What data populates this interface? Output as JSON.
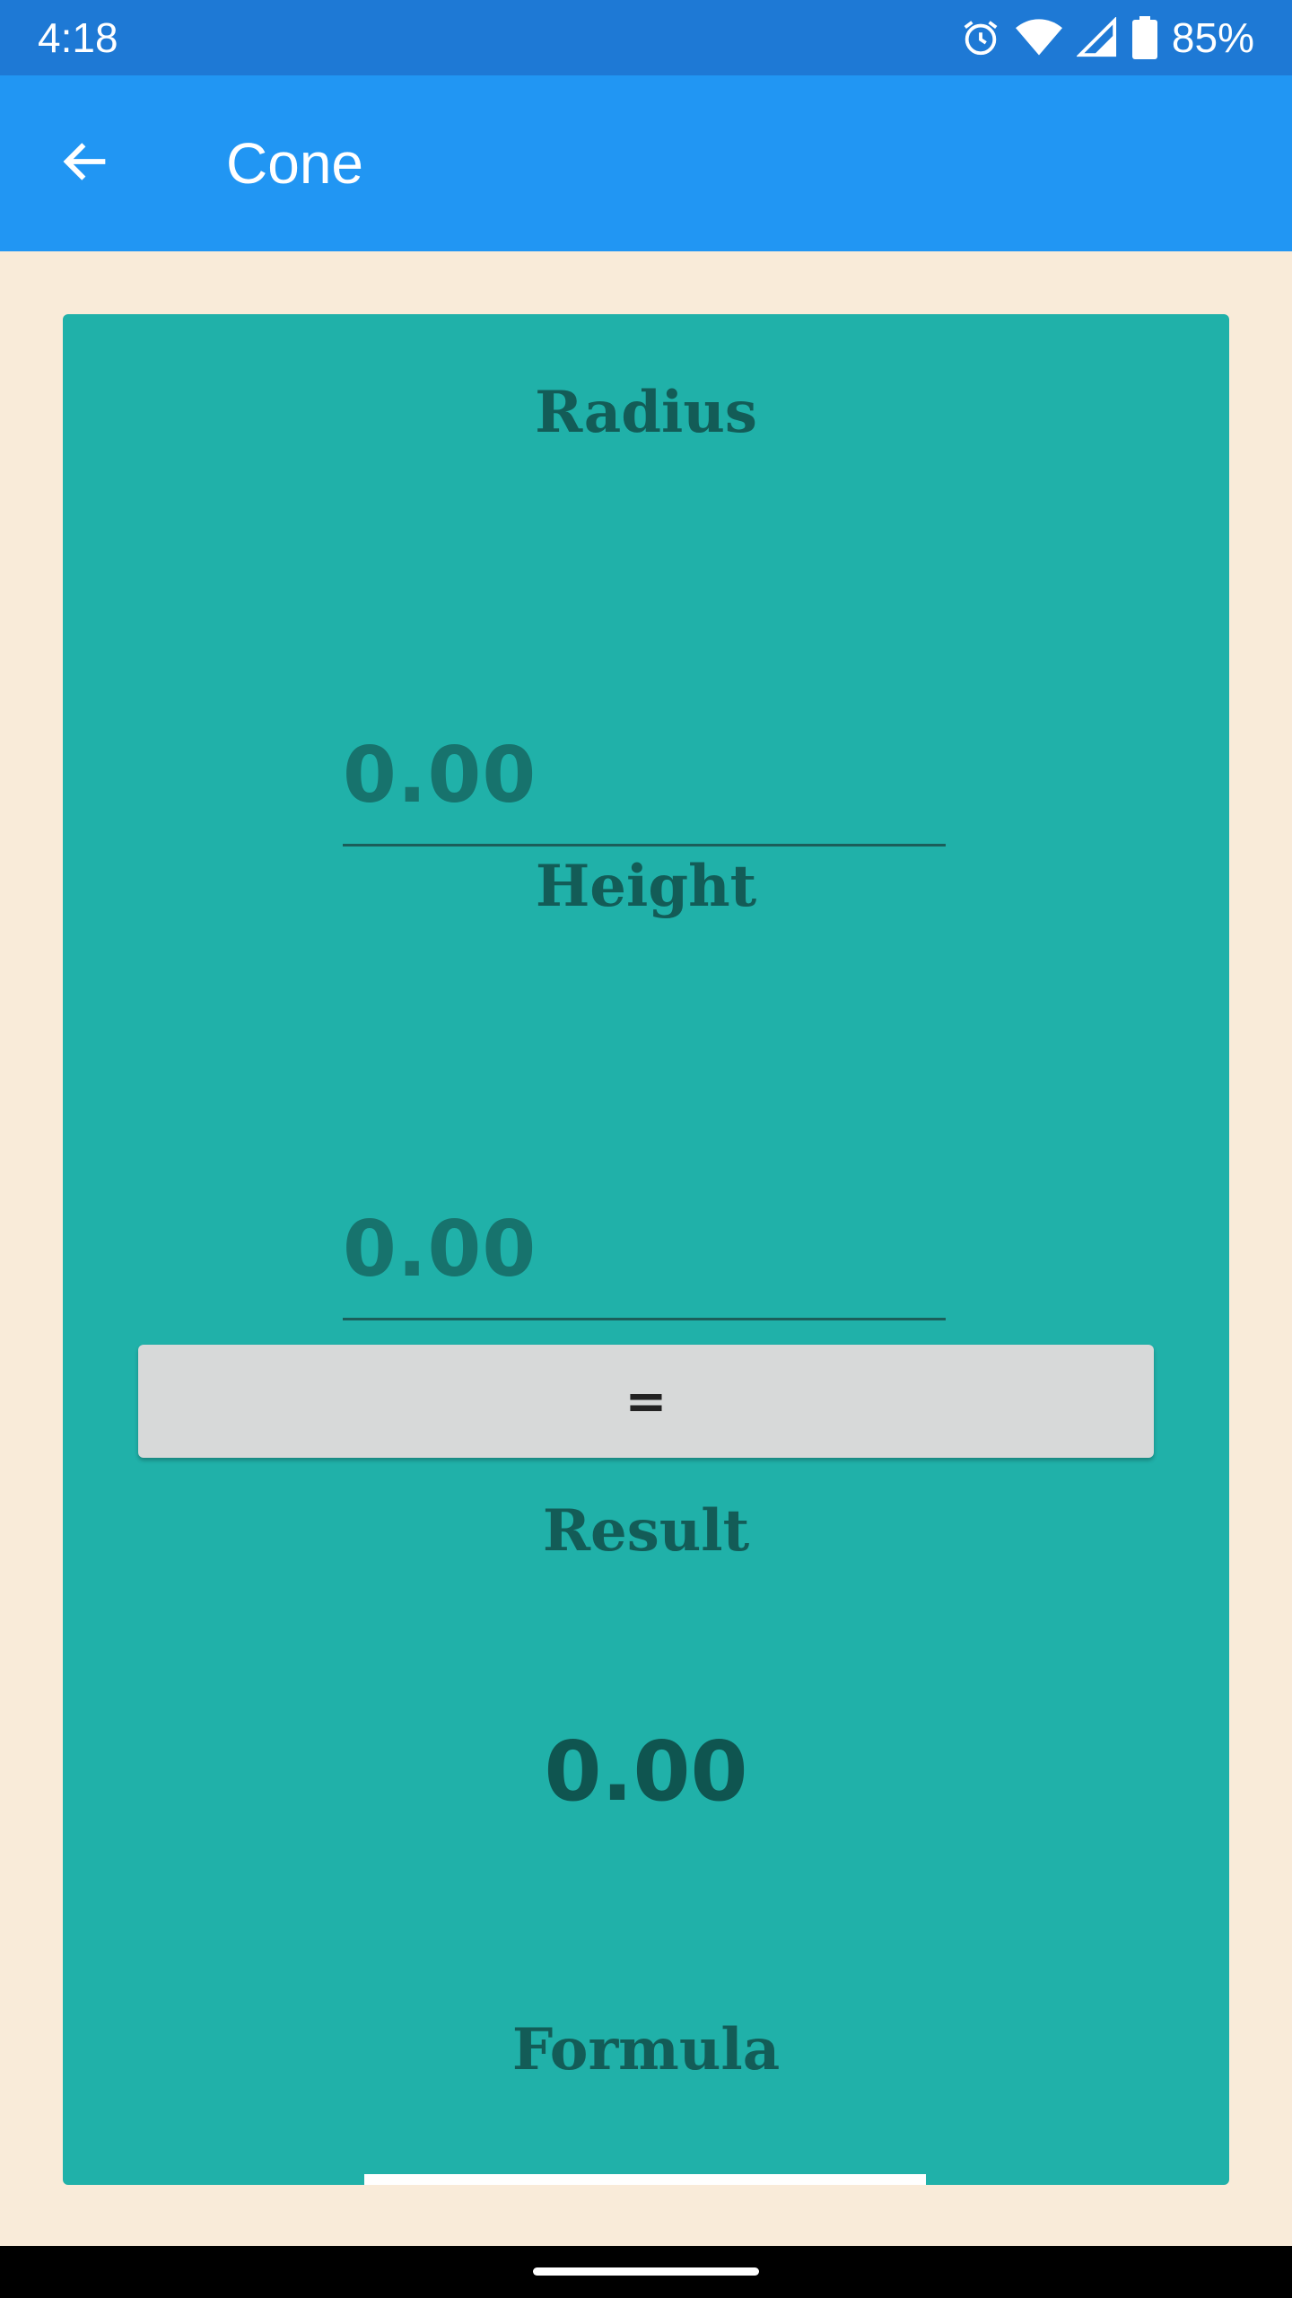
{
  "status_bar": {
    "time": "4:18",
    "battery": "85%",
    "icons": [
      "alarm-icon",
      "wifi-icon",
      "signal-icon",
      "battery-icon"
    ]
  },
  "app_bar": {
    "title": "Cone",
    "back_icon": "arrow-back-icon"
  },
  "form": {
    "radius_label": "Radius",
    "radius_placeholder": "0.00",
    "height_label": "Height",
    "height_placeholder": "0.00",
    "equals_label": "=",
    "result_label": "Result",
    "result_value": "0.00",
    "formula_label": "Formula"
  },
  "colors": {
    "status_bar": "#1E79D5",
    "app_bar": "#2196F3",
    "background": "#F9EBD9",
    "card": "#20B1A9",
    "button": "#D7D9D9"
  }
}
